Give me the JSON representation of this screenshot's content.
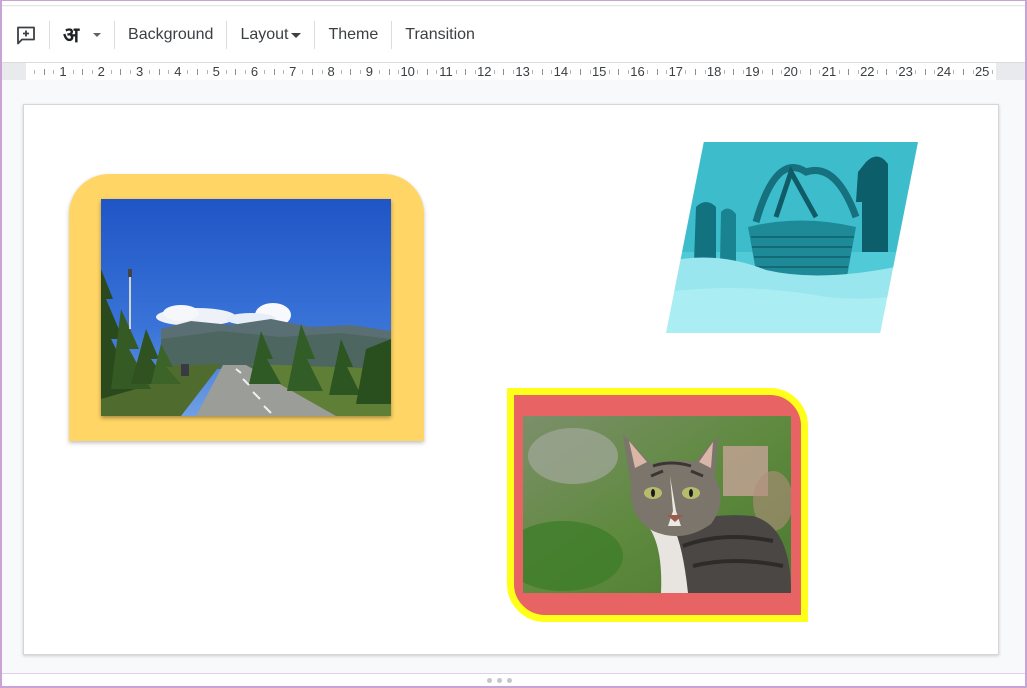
{
  "toolbar": {
    "items": [
      {
        "name": "add-comment-button",
        "icon": "add-comment-icon"
      },
      {
        "name": "input-tools-button",
        "label": "अ",
        "icon": "input-tools-icon"
      },
      {
        "name": "background-button",
        "label": "Background"
      },
      {
        "name": "layout-button",
        "label": "Layout",
        "has_dropdown": true
      },
      {
        "name": "theme-button",
        "label": "Theme"
      },
      {
        "name": "transition-button",
        "label": "Transition"
      }
    ]
  },
  "ruler": {
    "labels": [
      "1",
      "2",
      "3",
      "4",
      "5",
      "6",
      "7",
      "8",
      "9",
      "10",
      "11",
      "12",
      "13",
      "14",
      "15",
      "16",
      "17",
      "18",
      "19",
      "20",
      "21",
      "22",
      "23",
      "24",
      "25"
    ]
  },
  "slide": {
    "images": [
      {
        "name": "road-landscape-image",
        "description": "Road with trees and mountains under blue sky",
        "frame_color": "#ffd565",
        "frame_shape": "round-top-rectangle"
      },
      {
        "name": "wicker-basket-image",
        "description": "Wicker basket in snow, cyan recolor",
        "frame_shape": "parallelogram",
        "tint": "#4fd1db"
      },
      {
        "name": "tabby-cat-image",
        "description": "Tabby cat on blurred green background",
        "frame_color": "#e86363",
        "border_color": "#ffff1a",
        "frame_shape": "round-diagonal-corners"
      }
    ]
  },
  "colors": {
    "toolbar_text": "#3c4043",
    "accent_yellow": "#ffd565",
    "accent_coral": "#e86363",
    "outline_yellow": "#ffff1a"
  }
}
